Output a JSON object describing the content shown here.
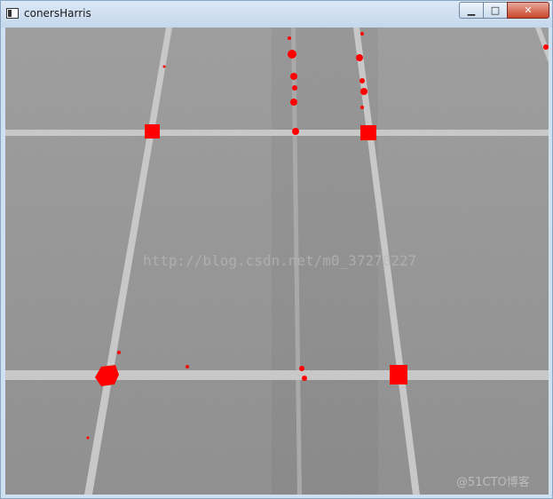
{
  "window": {
    "title": "conersHarris",
    "controls": {
      "minimize": "▁",
      "maximize": "□",
      "close": "✕"
    }
  },
  "image": {
    "watermark_center": "http://blog.csdn.net/m0_37278227",
    "watermark_corner": "@51CTO博客",
    "marker_color": "#ff0000",
    "floor_color": "#8f8f8f",
    "line_color": "#c8c8c8"
  }
}
